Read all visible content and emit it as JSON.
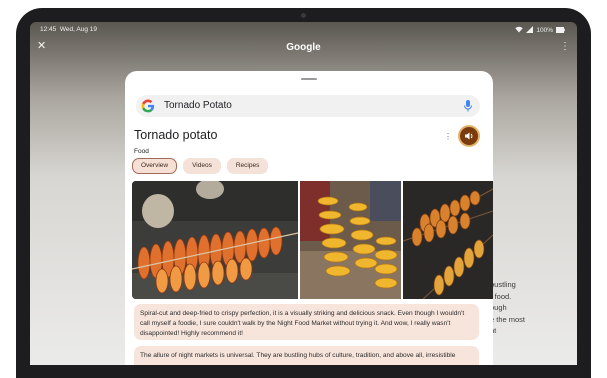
{
  "status": {
    "time": "12:45",
    "date": "Wed, Aug 19",
    "battery": "100%"
  },
  "topbar": {
    "title": "Google"
  },
  "background_text": [
    "bustling",
    "r food.",
    "ough",
    "e the most",
    "ht"
  ],
  "search": {
    "query": "Tornado Potato"
  },
  "entity": {
    "title": "Tornado potato",
    "category": "Food"
  },
  "tabs": [
    {
      "label": "Overview",
      "active": true
    },
    {
      "label": "Videos",
      "active": false
    },
    {
      "label": "Recipes",
      "active": false
    }
  ],
  "reviews": [
    {
      "text": "Spiral-cut and deep-fried to crispy perfection, it is a visually striking and delicious snack. Even though I wouldn't call myself a foodie, I sure couldn't walk by the Night Food Market without trying it. And wow, I really wasn't disappointed! Highly recommend it!"
    },
    {
      "text": "The allure of night markets is universal. They are bustling hubs of culture, tradition, and above all, irresistible"
    }
  ],
  "colors": {
    "chip_bg": "#f4e2d9",
    "chip_active_border": "#a26a58",
    "review_bg": "#f7e5dc",
    "audio_badge": "#7a3c0e"
  },
  "icons": {
    "close": "close-icon",
    "menu": "more-vert-icon",
    "google": "google-logo-icon",
    "mic": "mic-icon",
    "audio": "speaker-icon"
  }
}
